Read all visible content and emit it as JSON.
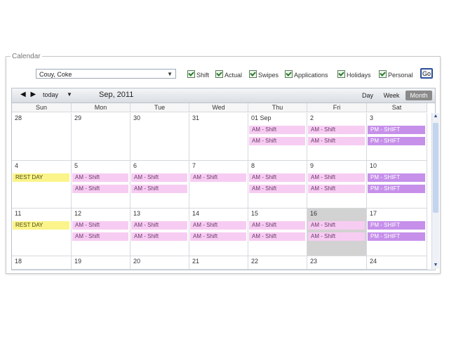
{
  "panel": {
    "title": "Calendar"
  },
  "employee": {
    "selected": "Couy, Coke",
    "caret": "▼"
  },
  "filters": [
    {
      "label": "Shift"
    },
    {
      "label": "Actual"
    },
    {
      "label": "Swipes"
    },
    {
      "label": "Applications"
    },
    {
      "label": "Holidays"
    },
    {
      "label": "Personal"
    }
  ],
  "go_label": "Go",
  "toolbar": {
    "nav": "◀ ▶",
    "today": "today",
    "today_caret": "▼",
    "month": "Sep, 2011",
    "views": [
      "Day",
      "Week",
      "Month"
    ],
    "active_view": "Month"
  },
  "days_of_week": [
    "Sun",
    "Mon",
    "Tue",
    "Wed",
    "Thu",
    "Fri",
    "Sat"
  ],
  "weeks": [
    [
      {
        "num": "28",
        "events": []
      },
      {
        "num": "29",
        "events": []
      },
      {
        "num": "30",
        "events": []
      },
      {
        "num": "31",
        "events": []
      },
      {
        "num": "01 Sep",
        "events": [
          {
            "label": "AM - Shift",
            "type": "am"
          },
          {
            "label": "AM - Shift",
            "type": "am"
          }
        ]
      },
      {
        "num": "2",
        "events": [
          {
            "label": "AM - Shift",
            "type": "am"
          },
          {
            "label": "AM - Shift",
            "type": "am"
          }
        ]
      },
      {
        "num": "3",
        "events": [
          {
            "label": "PM - SHIFT",
            "type": "pm"
          },
          {
            "label": "PM - SHIFT",
            "type": "pm"
          }
        ]
      }
    ],
    [
      {
        "num": "4",
        "events": [
          {
            "label": "REST DAY",
            "type": "rest"
          }
        ]
      },
      {
        "num": "5",
        "events": [
          {
            "label": "AM - Shift",
            "type": "am"
          },
          {
            "label": "AM - Shift",
            "type": "am"
          }
        ]
      },
      {
        "num": "6",
        "events": [
          {
            "label": "AM - Shift",
            "type": "am"
          },
          {
            "label": "AM - Shift",
            "type": "am"
          }
        ]
      },
      {
        "num": "7",
        "events": [
          {
            "label": "AM - Shift",
            "type": "am"
          }
        ]
      },
      {
        "num": "8",
        "events": [
          {
            "label": "AM - Shift",
            "type": "am"
          },
          {
            "label": "AM - Shift",
            "type": "am"
          }
        ]
      },
      {
        "num": "9",
        "events": [
          {
            "label": "AM - Shift",
            "type": "am"
          },
          {
            "label": "AM - Shift",
            "type": "am"
          }
        ]
      },
      {
        "num": "10",
        "events": [
          {
            "label": "PM - SHIFT",
            "type": "pm"
          },
          {
            "label": "PM - SHIFT",
            "type": "pm"
          }
        ]
      }
    ],
    [
      {
        "num": "11",
        "events": [
          {
            "label": "REST DAY",
            "type": "rest"
          }
        ]
      },
      {
        "num": "12",
        "events": [
          {
            "label": "AM - Shift",
            "type": "am"
          },
          {
            "label": "AM - Shift",
            "type": "am"
          }
        ]
      },
      {
        "num": "13",
        "events": [
          {
            "label": "AM - Shift",
            "type": "am"
          },
          {
            "label": "AM - Shift",
            "type": "am"
          }
        ]
      },
      {
        "num": "14",
        "events": [
          {
            "label": "AM - Shift",
            "type": "am"
          },
          {
            "label": "AM - Shift",
            "type": "am"
          }
        ]
      },
      {
        "num": "15",
        "events": [
          {
            "label": "AM - Shift",
            "type": "am"
          },
          {
            "label": "AM - Shift",
            "type": "am"
          }
        ]
      },
      {
        "num": "16",
        "today": true,
        "events": [
          {
            "label": "AM - Shift",
            "type": "am"
          },
          {
            "label": "AM - Shift",
            "type": "am"
          }
        ]
      },
      {
        "num": "17",
        "events": [
          {
            "label": "PM - SHIFT",
            "type": "pm"
          },
          {
            "label": "PM - SHIFT",
            "type": "pm"
          }
        ]
      }
    ],
    [
      {
        "num": "18",
        "events": []
      },
      {
        "num": "19",
        "events": []
      },
      {
        "num": "20",
        "events": []
      },
      {
        "num": "21",
        "events": []
      },
      {
        "num": "22",
        "events": []
      },
      {
        "num": "23",
        "events": []
      },
      {
        "num": "24",
        "events": []
      }
    ]
  ],
  "colors": {
    "am_event": "#f7ccf2",
    "pm_event": "#c690ea",
    "rest_event": "#fbf48a",
    "today_cell": "#d2d2d2"
  },
  "scrollbar": {
    "up": "▲",
    "down": "▼"
  }
}
